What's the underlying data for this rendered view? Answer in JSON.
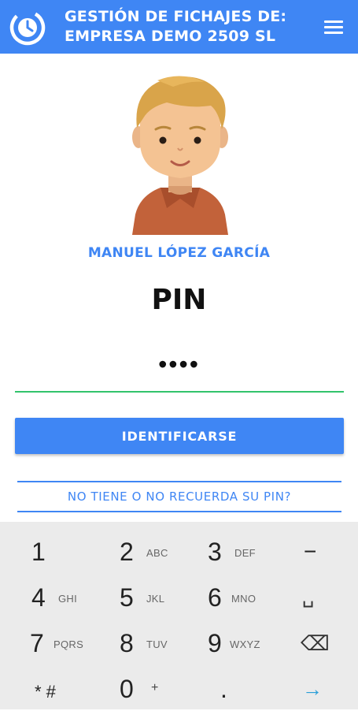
{
  "header": {
    "title": "GESTIÓN DE FICHAJES DE: EMPRESA DEMO 2509 SL",
    "bg_color": "#3f86f4",
    "logo_icon": "clock-icon",
    "menu_icon": "hamburger-menu-icon"
  },
  "user": {
    "name": "MANUEL LÓPEZ GARCÍA",
    "avatar_icon": "user-avatar-illustration"
  },
  "pin": {
    "label": "PIN",
    "value_masked": "••••",
    "underline_color": "#32c36c"
  },
  "actions": {
    "login_label": "IDENTIFICARSE",
    "forgot_label": "NO TIENE O NO RECUERDA SU PIN?"
  },
  "keyboard": {
    "keys": [
      {
        "digit": "1",
        "letters": ""
      },
      {
        "digit": "2",
        "letters": "ABC"
      },
      {
        "digit": "3",
        "letters": "DEF"
      },
      {
        "digit": "−",
        "letters": ""
      },
      {
        "digit": "4",
        "letters": "GHI"
      },
      {
        "digit": "5",
        "letters": "JKL"
      },
      {
        "digit": "6",
        "letters": "MNO"
      },
      {
        "digit": "␣",
        "letters": ""
      },
      {
        "digit": "7",
        "letters": "PQRS"
      },
      {
        "digit": "8",
        "letters": "TUV"
      },
      {
        "digit": "9",
        "letters": "WXYZ"
      },
      {
        "digit": "⌫",
        "letters": ""
      },
      {
        "digit": "* #",
        "letters": ""
      },
      {
        "digit": "0",
        "letters": "+"
      },
      {
        "digit": ".",
        "letters": ""
      },
      {
        "digit": "→",
        "letters": ""
      }
    ]
  }
}
